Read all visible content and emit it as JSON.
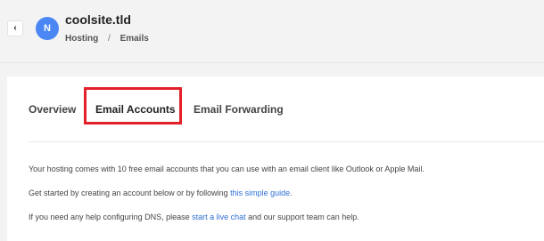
{
  "header": {
    "avatar_letter": "N",
    "site_title": "coolsite.tld",
    "breadcrumb": [
      "Hosting",
      "Emails"
    ],
    "breadcrumb_separator": "/"
  },
  "tabs": [
    {
      "label": "Overview"
    },
    {
      "label": "Email Accounts",
      "selected": true
    },
    {
      "label": "Email Forwarding"
    }
  ],
  "content": {
    "p1": "Your hosting comes with 10 free email accounts that you can use with an email client like Outlook or Apple Mail.",
    "p2_prefix": "Get started by creating an account below or by following ",
    "p2_link": "this simple guide",
    "p2_suffix": ".",
    "p3_prefix": "If you need any help configuring DNS, please ",
    "p3_link": "start a live chat",
    "p3_suffix": " and our support team can help."
  },
  "icons": {
    "back": "chevron-left-icon"
  },
  "colors": {
    "accent": "#4a87f5",
    "link": "#2d6fd6",
    "highlight": "#e3212b"
  }
}
